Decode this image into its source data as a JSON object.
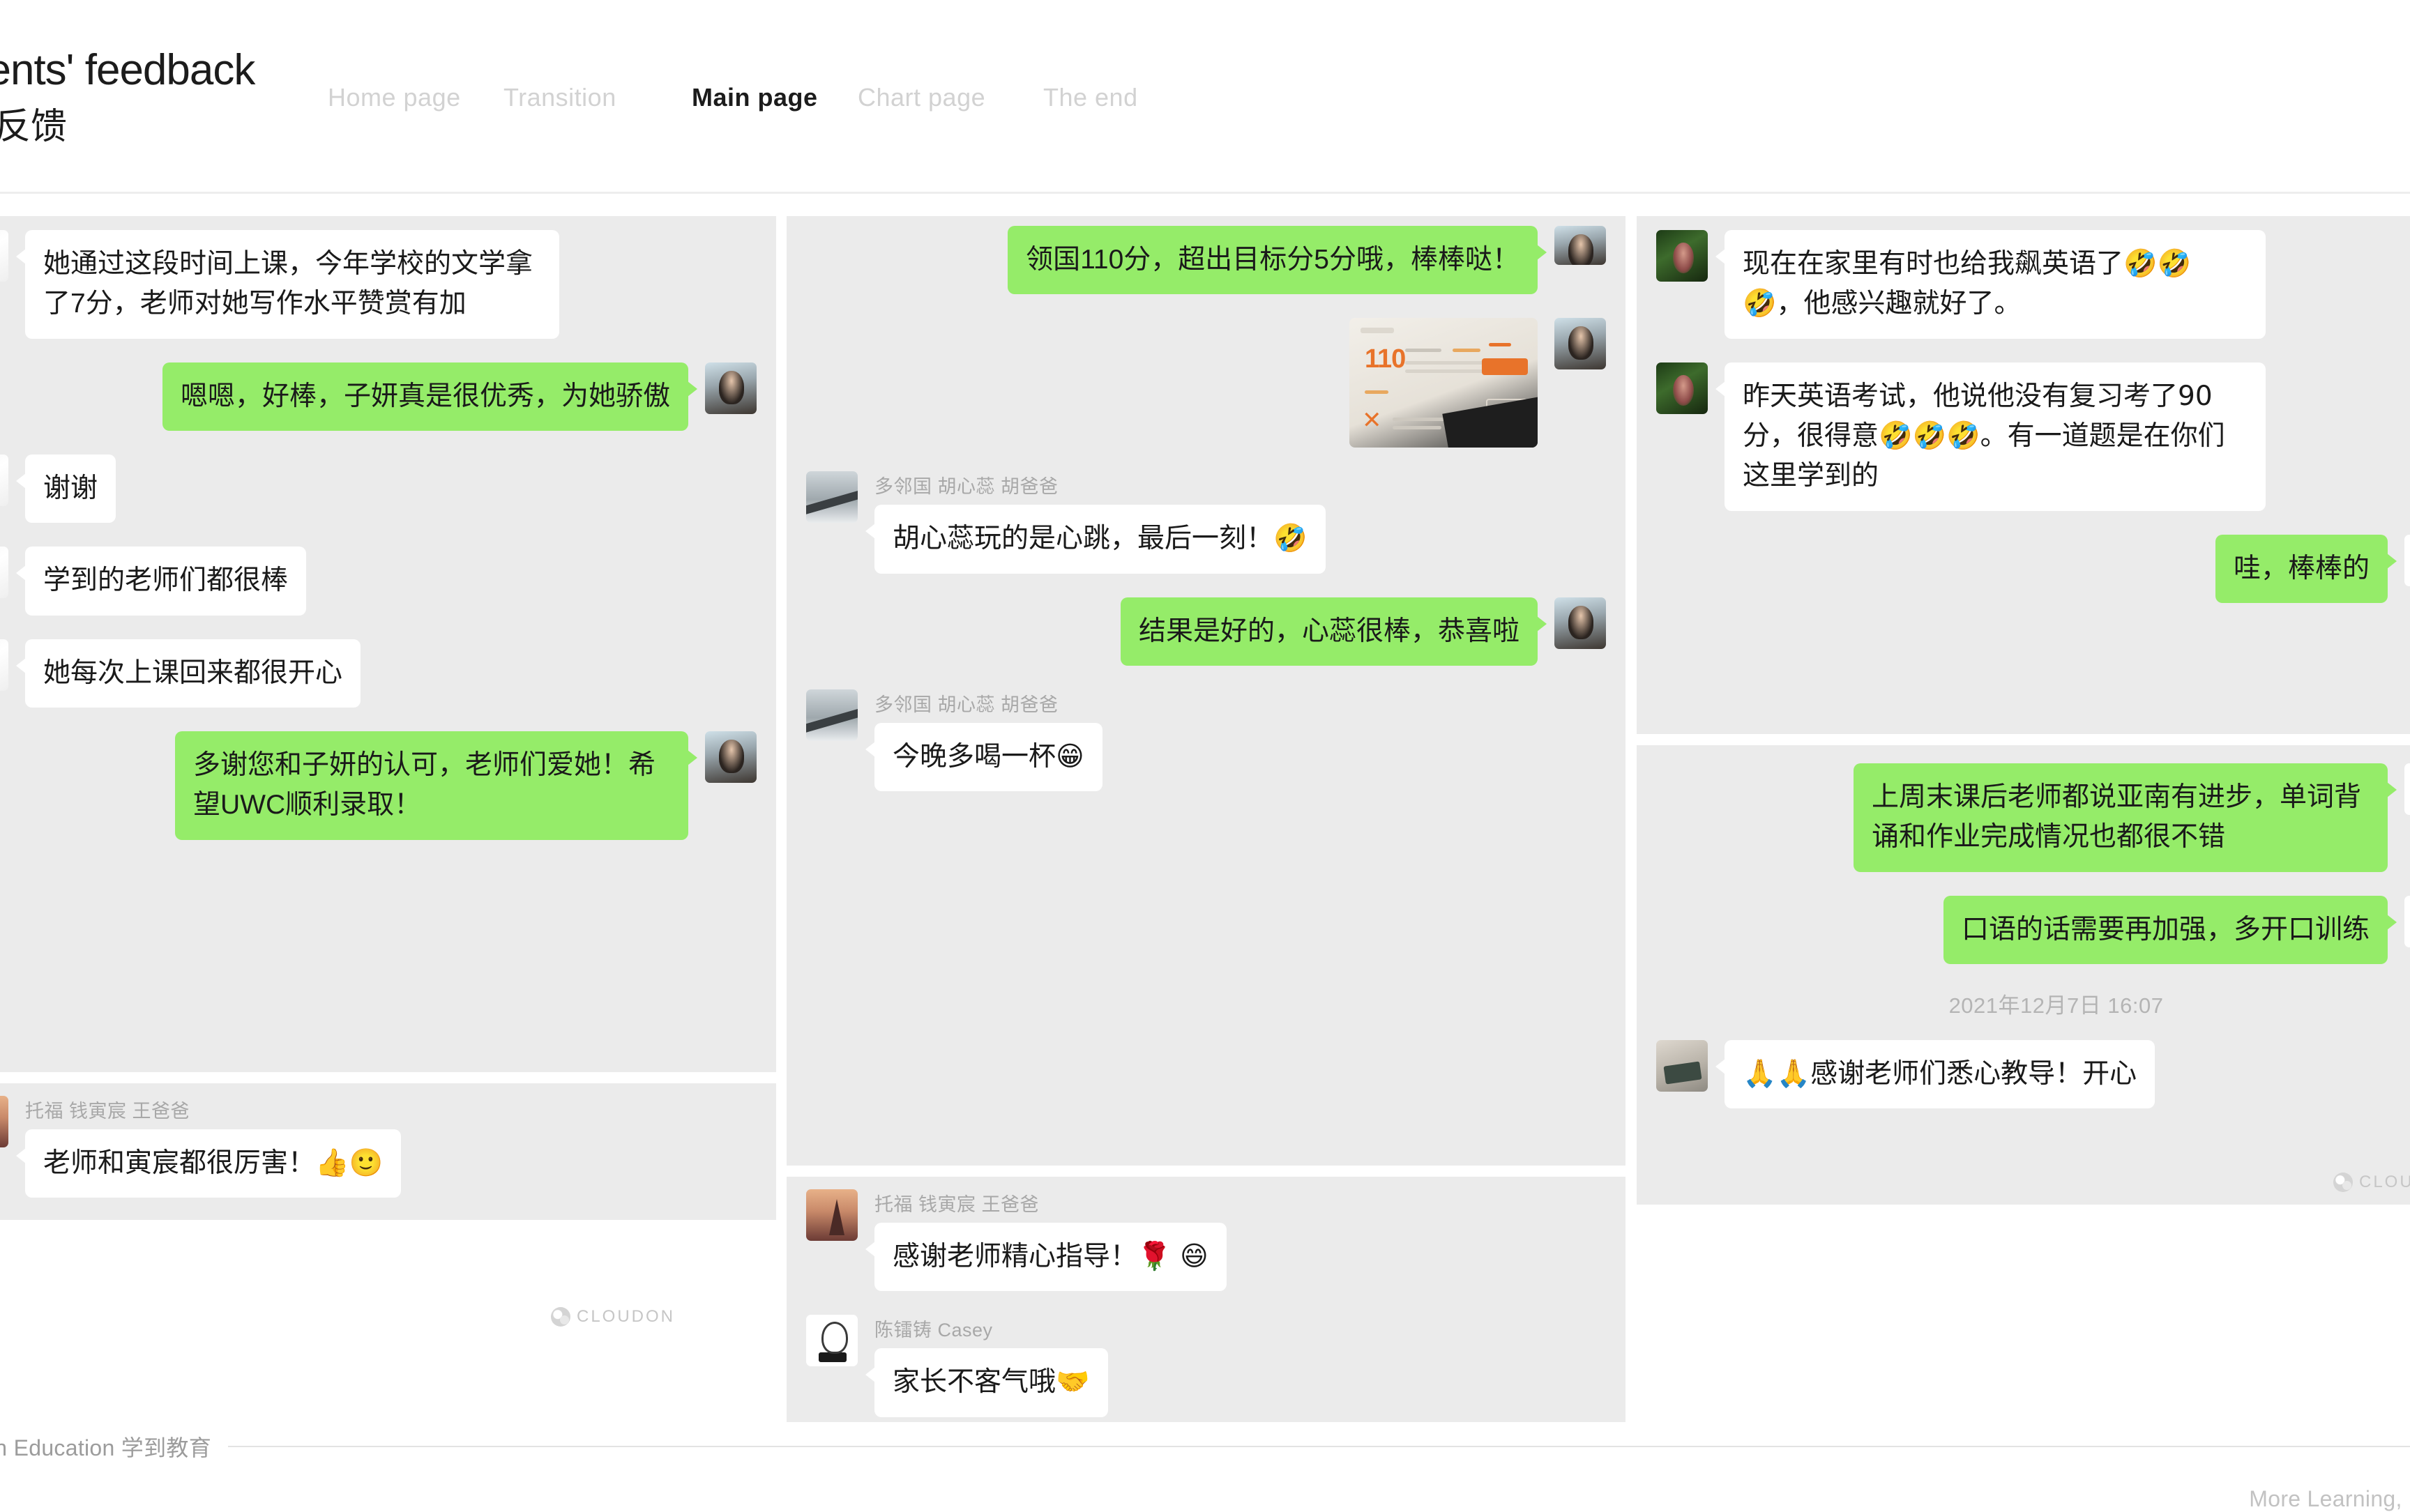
{
  "header": {
    "title_en": "Parents' feedback",
    "title_cn": "家长反馈",
    "nav": [
      {
        "label": "Home page",
        "active": false
      },
      {
        "label": "Transition",
        "active": false
      },
      {
        "label": "Main page",
        "active": true
      },
      {
        "label": "Chart page",
        "active": false
      },
      {
        "label": "The end",
        "active": false
      }
    ]
  },
  "watermark": {
    "text": "CLOUDON"
  },
  "columns": {
    "col1": {
      "card1": {
        "messages": [
          {
            "dir": "in",
            "avatar": "feather",
            "text": "她通过这段时间上课，今年学校的文学拿了7分，老师对她写作水平赞赏有加"
          },
          {
            "dir": "out",
            "avatar": "girl",
            "text": "嗯嗯，好棒，子妍真是很优秀，为她骄傲"
          },
          {
            "dir": "in",
            "avatar": "feather",
            "text": "谢谢"
          },
          {
            "dir": "in",
            "avatar": "feather",
            "text": "学到的老师们都很棒"
          },
          {
            "dir": "in",
            "avatar": "feather",
            "text": "她每次上课回来都很开心"
          },
          {
            "dir": "out",
            "avatar": "girl",
            "text": "多谢您和子妍的认可，老师们爱她！希望UWC顺利录取！"
          }
        ]
      },
      "card2": {
        "messages": [
          {
            "dir": "in",
            "avatar": "tower",
            "sender": "托福 钱寅宸 王爸爸",
            "text": "老师和寅宸都很厉害！👍🙂"
          }
        ]
      }
    },
    "col2": {
      "card1": {
        "messages": [
          {
            "dir": "out",
            "avatar": "girl",
            "text": "领国110分，超出目标分5分哦，棒棒哒！"
          },
          {
            "dir": "out",
            "avatar": "girl",
            "type": "photo",
            "photo_score": "110"
          },
          {
            "dir": "in",
            "avatar": "bridge",
            "sender": "多邻国 胡心蕊 胡爸爸",
            "text": "胡心蕊玩的是心跳，最后一刻！🤣"
          },
          {
            "dir": "out",
            "avatar": "girl",
            "text": "结果是好的，心蕊很棒，恭喜啦"
          },
          {
            "dir": "in",
            "avatar": "bridge",
            "sender": "多邻国 胡心蕊 胡爸爸",
            "text": "今晚多喝一杯😁"
          }
        ]
      },
      "card2": {
        "messages": [
          {
            "dir": "in",
            "avatar": "tower",
            "sender": "托福 钱寅宸 王爸爸",
            "text": "感谢老师精心指导！🌹 😄"
          },
          {
            "dir": "in",
            "avatar": "cartoon",
            "sender": "陈镭铸 Casey",
            "text": "家长不客气哦🤝"
          }
        ]
      }
    },
    "col3": {
      "card1": {
        "messages": [
          {
            "dir": "in",
            "avatar": "green",
            "text": "现在在家里有时也给我飙英语了🤣🤣🤣，他感兴趣就好了。"
          },
          {
            "dir": "in",
            "avatar": "green",
            "text": "昨天英语考试，他说他没有复习考了90分，很得意🤣🤣🤣。有一道题是在你们这里学到的"
          },
          {
            "dir": "out",
            "avatar": "woman",
            "text": "哇，棒棒的"
          }
        ]
      },
      "card2": {
        "messages": [
          {
            "dir": "out",
            "avatar": "woman",
            "text": "上周末课后老师都说亚南有进步，单词背诵和作业完成情况也都很不错"
          },
          {
            "dir": "out",
            "avatar": "woman",
            "text": "口语的话需要再加强，多开口训练"
          }
        ],
        "timestamp": "2021年12月7日 16:07",
        "after": [
          {
            "dir": "in",
            "avatar": "books",
            "text": "🙏🙏感谢老师们悉心教导！开心"
          }
        ]
      }
    }
  },
  "footer": {
    "brand": "CloudOn Education 学到教育",
    "tagline": "More Learning, More"
  }
}
